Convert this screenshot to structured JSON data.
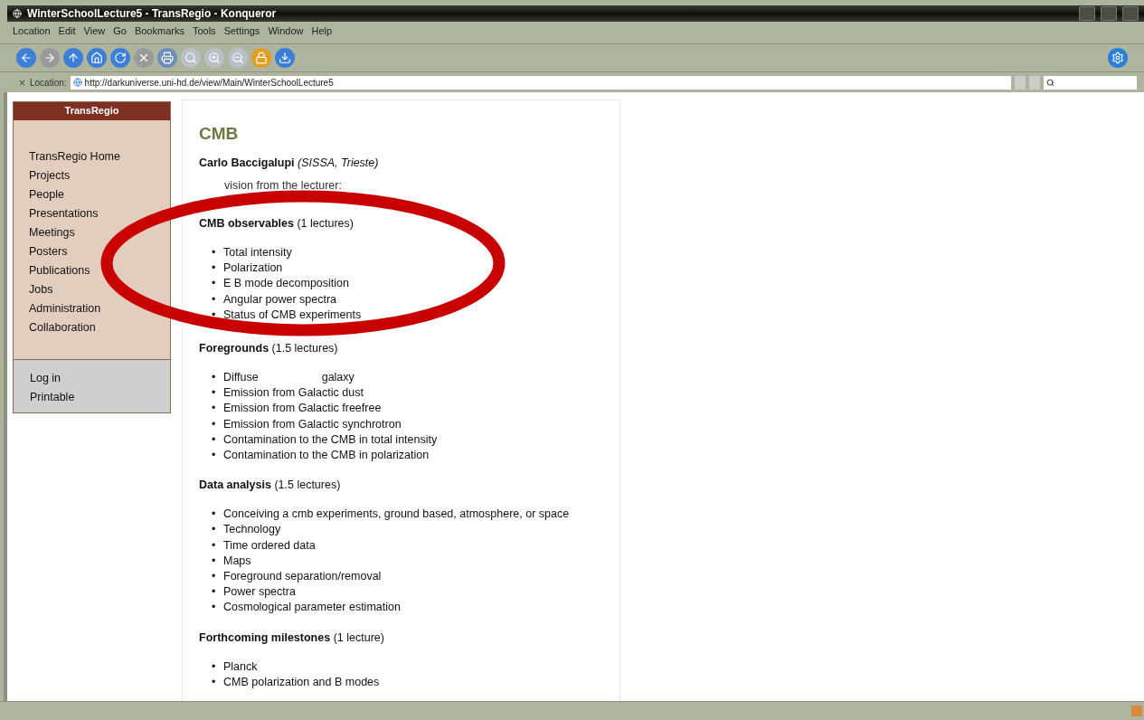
{
  "window": {
    "title": "WinterSchoolLecture5 - TransRegio - Konqueror"
  },
  "menu": [
    "Location",
    "Edit",
    "View",
    "Go",
    "Bookmarks",
    "Tools",
    "Settings",
    "Window",
    "Help"
  ],
  "location": {
    "label": "Location:",
    "value": "http://darkuniverse.uni-hd.de/view/Main/WinterSchoolLecture5"
  },
  "sidebar": {
    "title": "TransRegio",
    "items": [
      "TransRegio Home",
      "Projects",
      "People",
      "Presentations",
      "Meetings",
      "Posters",
      "Publications",
      "Jobs",
      "Administration",
      "Collaboration"
    ],
    "footer_items": [
      "Log in",
      "Printable"
    ]
  },
  "page": {
    "heading": "CMB",
    "author": "Carlo Baccigalupi",
    "affiliation": "(SISSA, Trieste)",
    "note": "vision from the lecturer:",
    "sections": [
      {
        "title": "CMB observables",
        "extent": "(1 lectures)",
        "items": [
          {
            "bullet": "•",
            "text": "Total intensity"
          },
          {
            "bullet": "•",
            "text": "Polarization"
          },
          {
            "bullet": "•",
            "text": "E B mode decomposition"
          },
          {
            "bullet": "•",
            "text": "Angular power spectra"
          },
          {
            "bullet": "•",
            "text": "Status of CMB experiments"
          }
        ]
      },
      {
        "title": "Foregrounds",
        "extent": "(1.5 lectures)",
        "items": [
          {
            "bullet": "•",
            "text": "Diffuse",
            "tail": "galaxy"
          },
          {
            "bullet": "•",
            "text": "Emission from Galactic dust"
          },
          {
            "bullet": "•",
            "text": "Emission from Galactic freefree"
          },
          {
            "bullet": "•",
            "text": "Emission from Galactic synchrotron"
          },
          {
            "bullet": "•",
            "text": "Contamination to the CMB in total intensity"
          },
          {
            "bullet": "•",
            "text": "Contamination to the CMB in polarization"
          }
        ]
      },
      {
        "title": "Data analysis",
        "extent": "(1.5 lectures)",
        "items": [
          {
            "bullet": "•",
            "text": "Conceiving a cmb experiments, ground based, atmosphere, or space"
          },
          {
            "bullet": "•",
            "text": "Technology"
          },
          {
            "bullet": "•",
            "text": "Time ordered data"
          },
          {
            "bullet": "•",
            "text": "Maps"
          },
          {
            "bullet": "•",
            "text": "Foreground separation/removal"
          },
          {
            "bullet": "•",
            "text": "Power spectra"
          },
          {
            "bullet": "•",
            "text": "Cosmological parameter estimation"
          }
        ]
      },
      {
        "title": "Forthcoming milestones",
        "extent": "(1 lecture)",
        "items": [
          {
            "bullet": "•",
            "text": "Planck"
          },
          {
            "bullet": "•",
            "text": "CMB polarization and B modes"
          }
        ]
      }
    ]
  }
}
